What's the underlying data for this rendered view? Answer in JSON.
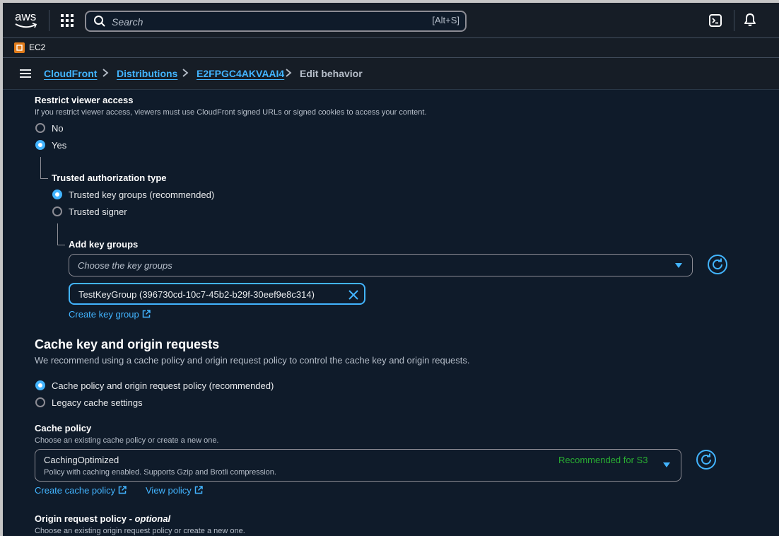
{
  "topnav": {
    "logo_text": "aws",
    "search_placeholder": "Search",
    "search_shortcut": "[Alt+S]"
  },
  "favorites": {
    "ec2_label": "EC2"
  },
  "breadcrumb": {
    "items": [
      "CloudFront",
      "Distributions",
      "E2FPGC4AKVAAI4"
    ],
    "current": "Edit behavior"
  },
  "restrict": {
    "label": "Restrict viewer access",
    "description": "If you restrict viewer access, viewers must use CloudFront signed URLs or signed cookies to access your content.",
    "options": [
      "No",
      "Yes"
    ],
    "selected": "Yes"
  },
  "trusted_auth": {
    "label": "Trusted authorization type",
    "options": [
      "Trusted key groups (recommended)",
      "Trusted signer"
    ],
    "selected": "Trusted key groups (recommended)"
  },
  "key_groups": {
    "label": "Add key groups",
    "placeholder": "Choose the key groups",
    "token": "TestKeyGroup (396730cd-10c7-45b2-b29f-30eef9e8c314)",
    "create_link": "Create key group"
  },
  "cache_section": {
    "heading": "Cache key and origin requests",
    "description": "We recommend using a cache policy and origin request policy to control the cache key and origin requests.",
    "options": [
      "Cache policy and origin request policy (recommended)",
      "Legacy cache settings"
    ],
    "selected": "Cache policy and origin request policy (recommended)"
  },
  "cache_policy": {
    "label": "Cache policy",
    "description": "Choose an existing cache policy or create a new one.",
    "value": "CachingOptimized",
    "value_description": "Policy with caching enabled. Supports Gzip and Brotli compression.",
    "badge": "Recommended for S3",
    "create_link": "Create cache policy",
    "view_link": "View policy"
  },
  "origin_policy": {
    "label": "Origin request policy",
    "label_suffix": "optional",
    "description": "Choose an existing origin request policy or create a new one."
  },
  "colors": {
    "accent": "#42b4ff",
    "background": "#0f1b2a",
    "header": "#161d26",
    "success": "#29ad32"
  }
}
